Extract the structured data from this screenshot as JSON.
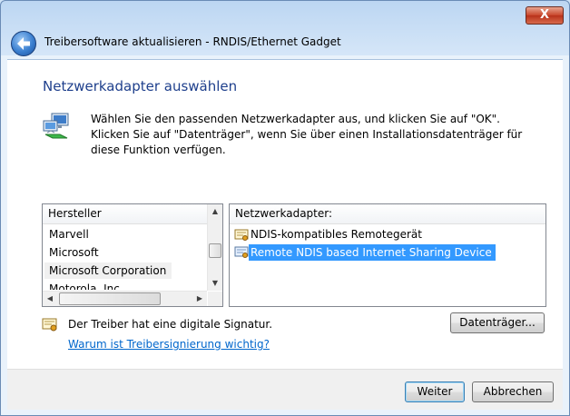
{
  "titlebar": {
    "close_label": "X"
  },
  "nav": {
    "title": "Treibersoftware aktualisieren - RNDIS/Ethernet Gadget"
  },
  "page": {
    "heading": "Netzwerkadapter auswählen",
    "instructions": "Wählen Sie den passenden Netzwerkadapter aus, und klicken Sie auf \"OK\". Klicken Sie auf \"Datenträger\", wenn Sie über einen Installationsdatenträger für diese Funktion verfügen."
  },
  "manufacturers": {
    "header": "Hersteller",
    "items": [
      "Marvell",
      "Microsoft",
      "Microsoft Corporation",
      "Motorola, Inc."
    ],
    "selected": "Microsoft Corporation"
  },
  "adapters": {
    "header": "Netzwerkadapter:",
    "items": [
      "NDIS-kompatibles Remotegerät",
      "Remote NDIS based Internet Sharing Device"
    ],
    "selected": "Remote NDIS based Internet Sharing Device"
  },
  "signature": {
    "text": "Der Treiber hat eine digitale Signatur.",
    "link": "Warum ist Treibersignierung wichtig?"
  },
  "buttons": {
    "disk": "Datenträger...",
    "next": "Weiter",
    "cancel": "Abbrechen"
  },
  "icons": {
    "back": "back-arrow-icon",
    "network": "network-adapter-icon",
    "driver": "driver-certificate-icon"
  },
  "colors": {
    "heading": "#1e3f8c",
    "selection": "#3399ff",
    "link": "#0066cc"
  }
}
